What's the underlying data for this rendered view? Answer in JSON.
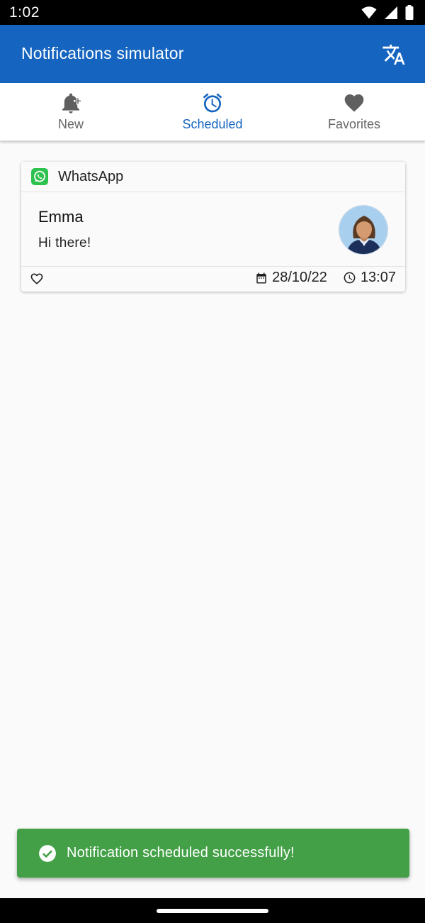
{
  "status_bar": {
    "time": "1:02",
    "icons": [
      "wifi-icon",
      "signal-icon",
      "battery-icon"
    ]
  },
  "app_bar": {
    "title": "Notifications simulator",
    "action_icon": "translate-icon",
    "color": "#1565c0"
  },
  "tabs": [
    {
      "label": "New",
      "icon": "add-alert-icon",
      "active": false
    },
    {
      "label": "Scheduled",
      "icon": "alarm-icon",
      "active": true
    },
    {
      "label": "Favorites",
      "icon": "heart-icon",
      "active": false
    }
  ],
  "notifications": [
    {
      "app": "WhatsApp",
      "app_icon": "whatsapp-icon",
      "sender": "Emma",
      "message": "Hi there!",
      "avatar": "woman-avatar",
      "favorite": false,
      "date": "28/10/22",
      "time": "13:07"
    }
  ],
  "snackbar": {
    "text": "Notification scheduled successfully!",
    "icon": "check-circle-icon",
    "color": "#43a047"
  }
}
